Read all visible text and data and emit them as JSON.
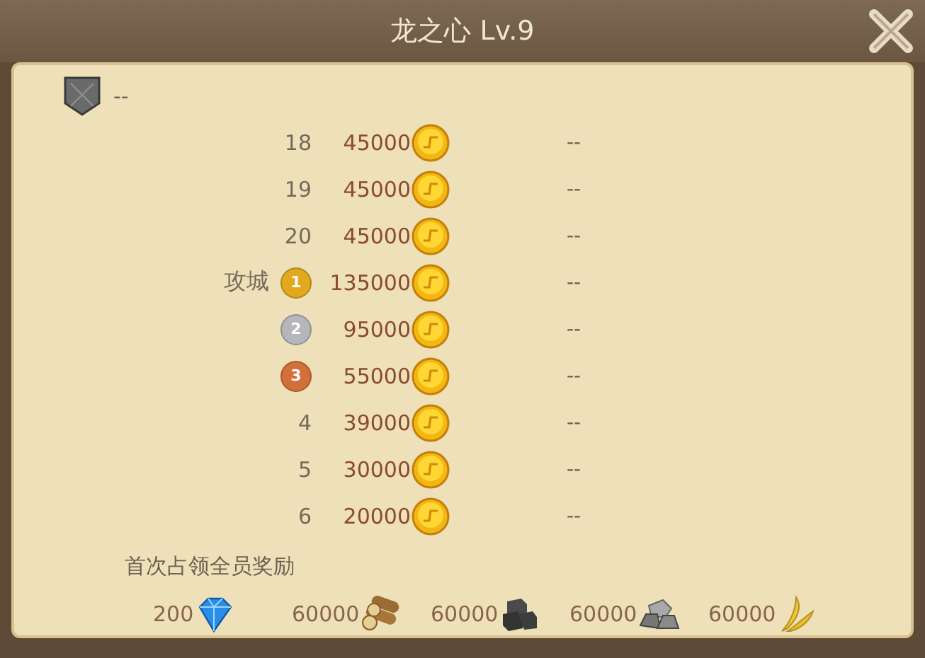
{
  "window": {
    "title": "龙之心 Lv.9"
  },
  "owner": {
    "value": "--"
  },
  "rows": [
    {
      "kind": "number",
      "rank": "18",
      "amount": "45000",
      "value": "--"
    },
    {
      "kind": "number",
      "rank": "19",
      "amount": "45000",
      "value": "--"
    },
    {
      "kind": "number",
      "rank": "20",
      "amount": "45000",
      "value": "--"
    },
    {
      "kind": "medal",
      "label": "攻城",
      "rank": "1",
      "color": "#e2a91e",
      "amount": "135000",
      "value": "--"
    },
    {
      "kind": "medal",
      "rank": "2",
      "color": "#b4b6ba",
      "amount": "95000",
      "value": "--"
    },
    {
      "kind": "medal",
      "rank": "3",
      "color": "#d2703a",
      "amount": "55000",
      "value": "--"
    },
    {
      "kind": "number",
      "rank": "4",
      "amount": "39000",
      "value": "--"
    },
    {
      "kind": "number",
      "rank": "5",
      "amount": "30000",
      "value": "--"
    },
    {
      "kind": "number",
      "rank": "6",
      "amount": "20000",
      "value": "--"
    }
  ],
  "rewards": {
    "title": "首次占领全员奖励",
    "items": [
      {
        "kind": "gem",
        "amount": "200"
      },
      {
        "kind": "wood",
        "amount": "60000"
      },
      {
        "kind": "iron",
        "amount": "60000"
      },
      {
        "kind": "stone",
        "amount": "60000"
      },
      {
        "kind": "wheat",
        "amount": "60000"
      }
    ]
  }
}
